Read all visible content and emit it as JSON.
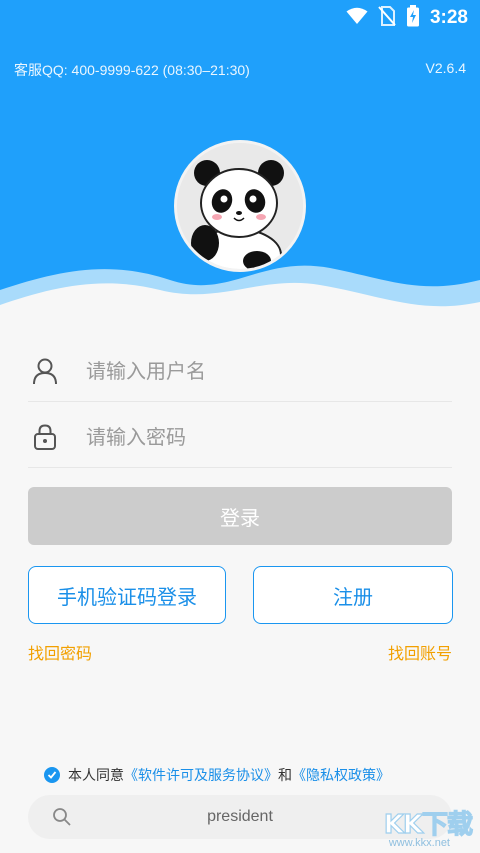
{
  "status_bar": {
    "time": "3:28",
    "icons": [
      "wifi-icon",
      "no-sim-icon",
      "battery-charging-icon"
    ]
  },
  "header": {
    "support_text": "客服QQ: 400-9999-622 (08:30–21:30)",
    "version": "V2.6.4",
    "avatar": "panda-avatar",
    "colors": {
      "header_blue": "#1fa0fb",
      "wave_light": "#a9dbfb"
    }
  },
  "form": {
    "username": {
      "placeholder": "请输入用户名",
      "value": "",
      "icon": "user-icon"
    },
    "password": {
      "placeholder": "请输入密码",
      "value": "",
      "icon": "lock-icon"
    },
    "login_label": "登录",
    "sms_login_label": "手机验证码登录",
    "register_label": "注册",
    "find_password": "找回密码",
    "find_account": "找回账号"
  },
  "agreement": {
    "checked": true,
    "prefix": "本人同意",
    "license_link": "《软件许可及服务协议》",
    "joiner": "和",
    "privacy_link": "《隐私权政策》"
  },
  "search": {
    "text": "president",
    "icon": "search-icon"
  },
  "watermark": {
    "logo": "KK下载",
    "site": "www.kkx.net"
  },
  "colors": {
    "accent": "#1a96f0",
    "link_orange": "#f2a000",
    "disabled_button": "#cccccc",
    "background": "#f7f7f7"
  }
}
